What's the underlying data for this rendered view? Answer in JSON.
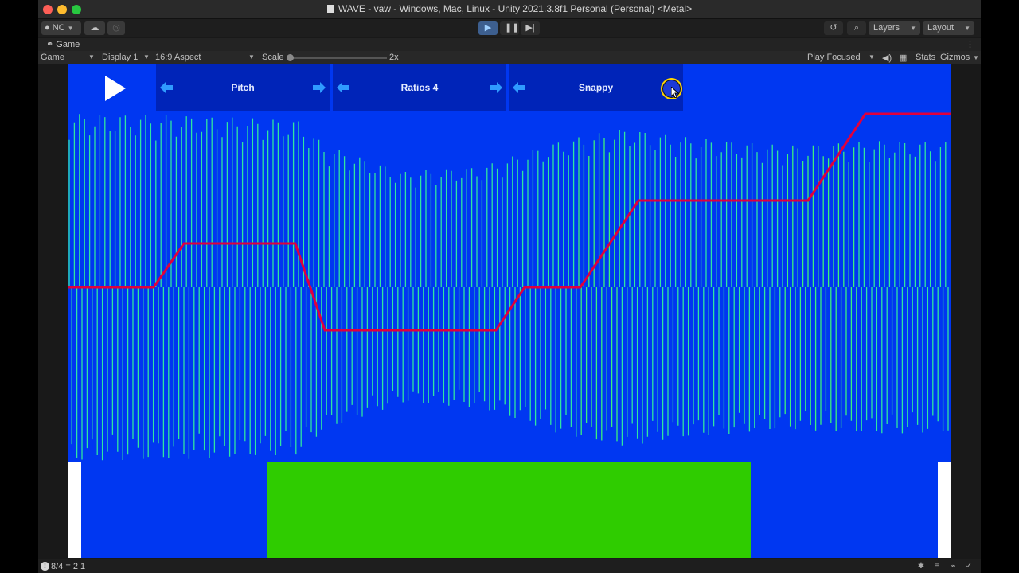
{
  "window": {
    "title": "WAVE - vaw - Windows, Mac, Linux - Unity 2021.3.8f1 Personal (Personal) <Metal>"
  },
  "toolbar": {
    "account_label": "NC",
    "layers_label": "Layers",
    "layout_label": "Layout",
    "icons": [
      "account-icon",
      "cloud-icon",
      "collab-icon",
      "play-icon",
      "pause-icon",
      "step-icon",
      "history-icon",
      "search-icon",
      "more-icon"
    ]
  },
  "tab": {
    "label": "Game"
  },
  "gamebar": {
    "mode": "Game",
    "display": "Display 1",
    "aspect": "16:9 Aspect",
    "scale_label": "Scale",
    "scale_value": "2x",
    "play_mode": "Play Focused",
    "stats": "Stats",
    "gizmos": "Gizmos"
  },
  "game_ui": {
    "selectors": [
      {
        "label": "Pitch"
      },
      {
        "label": "Ratios 4"
      },
      {
        "label": "Snappy"
      }
    ]
  },
  "colors": {
    "background": "#0037f1",
    "selector_bg": "#0024b8",
    "arrow": "#2f9bff",
    "waveform": "#2fe6a0",
    "pitch_line": "#e0003c",
    "block": "#2fcc00"
  },
  "status": {
    "text": "8/4 = 2 1"
  }
}
